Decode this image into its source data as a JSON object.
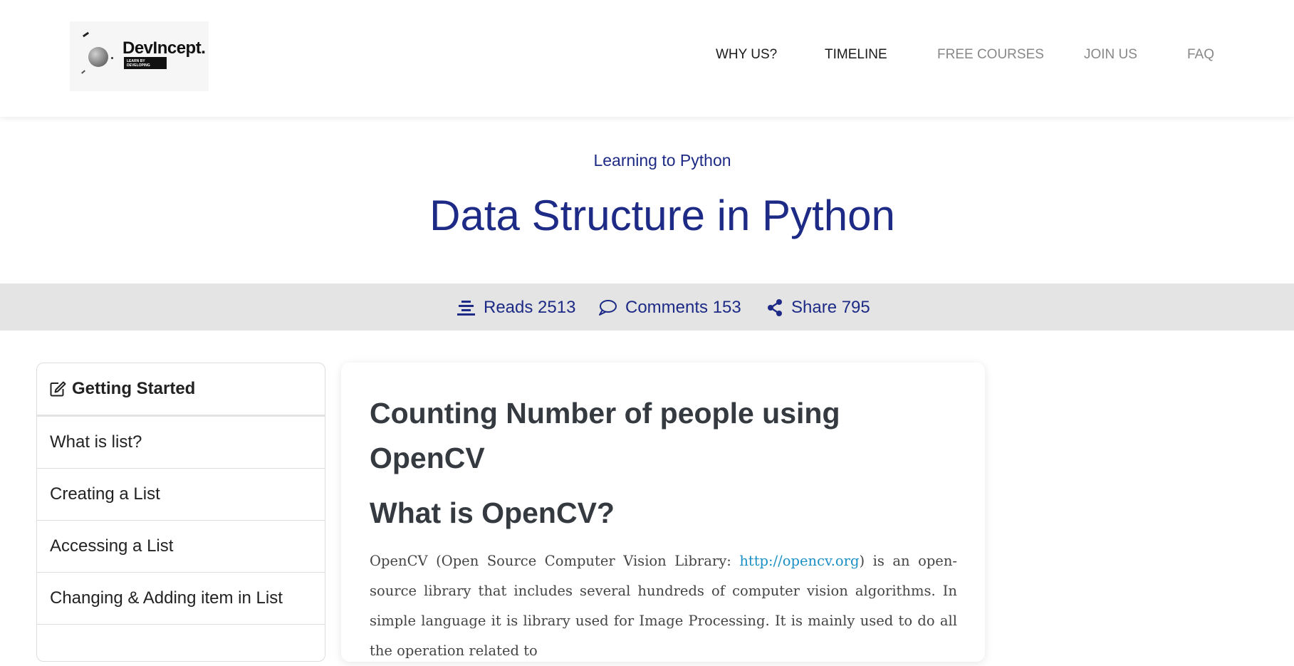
{
  "logo": {
    "name": "DevIncept.",
    "tagline": "LEARN BY DEVELOPING"
  },
  "nav": {
    "items": [
      {
        "label": "WHY US?"
      },
      {
        "label": "TIMELINE"
      },
      {
        "label": "FREE COURSES"
      },
      {
        "label": "JOIN US"
      },
      {
        "label": "FAQ"
      }
    ]
  },
  "hero": {
    "subtitle": "Learning to Python",
    "title": "Data Structure in Python"
  },
  "stats": {
    "reads": "Reads 2513",
    "comments": "Comments 153",
    "share": "Share 795"
  },
  "sidebar": {
    "heading": "Getting Started",
    "items": [
      {
        "label": "What is list?"
      },
      {
        "label": "Creating a List"
      },
      {
        "label": "Accessing a List"
      },
      {
        "label": "Changing & Adding item in List"
      }
    ]
  },
  "article": {
    "title": "Counting Number of people using OpenCV",
    "section_title": "What is OpenCV?",
    "para_before_link": "OpenCV (Open Source Computer Vision Library: ",
    "link_text": "http://opencv.org",
    "para_after_link": ") is an open-source library that includes several hundreds of computer vision algorithms. In simple language it is library used for Image Processing. It is mainly used to do all the operation related to"
  },
  "colors": {
    "primary": "#1d2a86",
    "link": "#1a8fc4",
    "stats_bg": "#e4e4e4",
    "heading_text": "#343a40"
  }
}
